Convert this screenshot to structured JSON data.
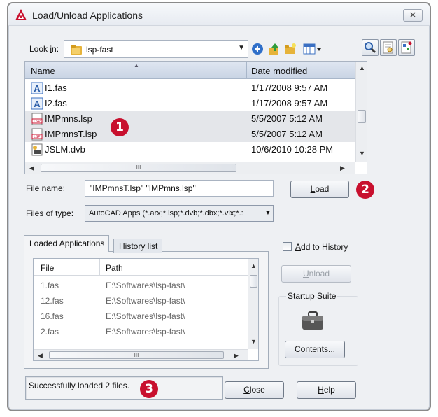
{
  "window": {
    "title": "Load/Unload Applications",
    "close_glyph": "✕"
  },
  "lookin": {
    "label_pre": "Look ",
    "label_mnemonic": "i",
    "label_post": "n:",
    "value": "lsp-fast"
  },
  "file_list": {
    "col_name": "Name",
    "col_date": "Date modified",
    "rows": [
      {
        "name": "I1.fas",
        "date": "1/17/2008 9:57 AM",
        "icon": "autocad-a-icon"
      },
      {
        "name": "I2.fas",
        "date": "1/17/2008 9:57 AM",
        "icon": "autocad-a-icon"
      },
      {
        "name": "IMPmns.lsp",
        "date": "5/5/2007 5:12 AM",
        "icon": "lsp-file-icon"
      },
      {
        "name": "IMPmnsT.lsp",
        "date": "5/5/2007 5:12 AM",
        "icon": "lsp-file-icon"
      },
      {
        "name": "JSLM.dvb",
        "date": "10/6/2010 10:28 PM",
        "icon": "dvb-file-icon"
      }
    ],
    "hscroll_grip": "III"
  },
  "file_name": {
    "label_pre": "File ",
    "label_mnemonic": "n",
    "label_post": "ame:",
    "value": "\"IMPmnsT.lsp\" \"IMPmns.lsp\""
  },
  "files_of_type": {
    "label": "Files of type:",
    "value": "AutoCAD Apps (*.arx;*.lsp;*.dvb;*.dbx;*.vlx;*.:"
  },
  "buttons": {
    "load_mnemonic": "L",
    "load_rest": "oad",
    "unload_mnemonic": "U",
    "unload_rest": "nload",
    "contents_mnemonic": "o",
    "contents_pre": "C",
    "contents_rest": "ntents...",
    "close_mnemonic": "C",
    "close_rest": "lose",
    "help_mnemonic": "H",
    "help_rest": "elp"
  },
  "tabs": {
    "loaded": "Loaded Applications",
    "history": "History list"
  },
  "loaded_apps": {
    "col_file": "File",
    "col_path": "Path",
    "rows": [
      {
        "file": "1.fas",
        "path": "E:\\Softwares\\lsp-fast\\"
      },
      {
        "file": "12.fas",
        "path": "E:\\Softwares\\lsp-fast\\"
      },
      {
        "file": "16.fas",
        "path": "E:\\Softwares\\lsp-fast\\"
      },
      {
        "file": "2.fas",
        "path": "E:\\Softwares\\lsp-fast\\"
      }
    ],
    "hscroll_grip": "III"
  },
  "add_to_history": {
    "label_mnemonic": "A",
    "label_rest": "dd to History"
  },
  "startup_suite": {
    "label": "Startup Suite"
  },
  "status": {
    "text": "Successfully loaded 2 files."
  },
  "callouts": [
    "1",
    "2",
    "3"
  ],
  "colors": {
    "callout": "#c8102e",
    "selection": "#e4e6ea",
    "header": "#c9d4e4"
  }
}
